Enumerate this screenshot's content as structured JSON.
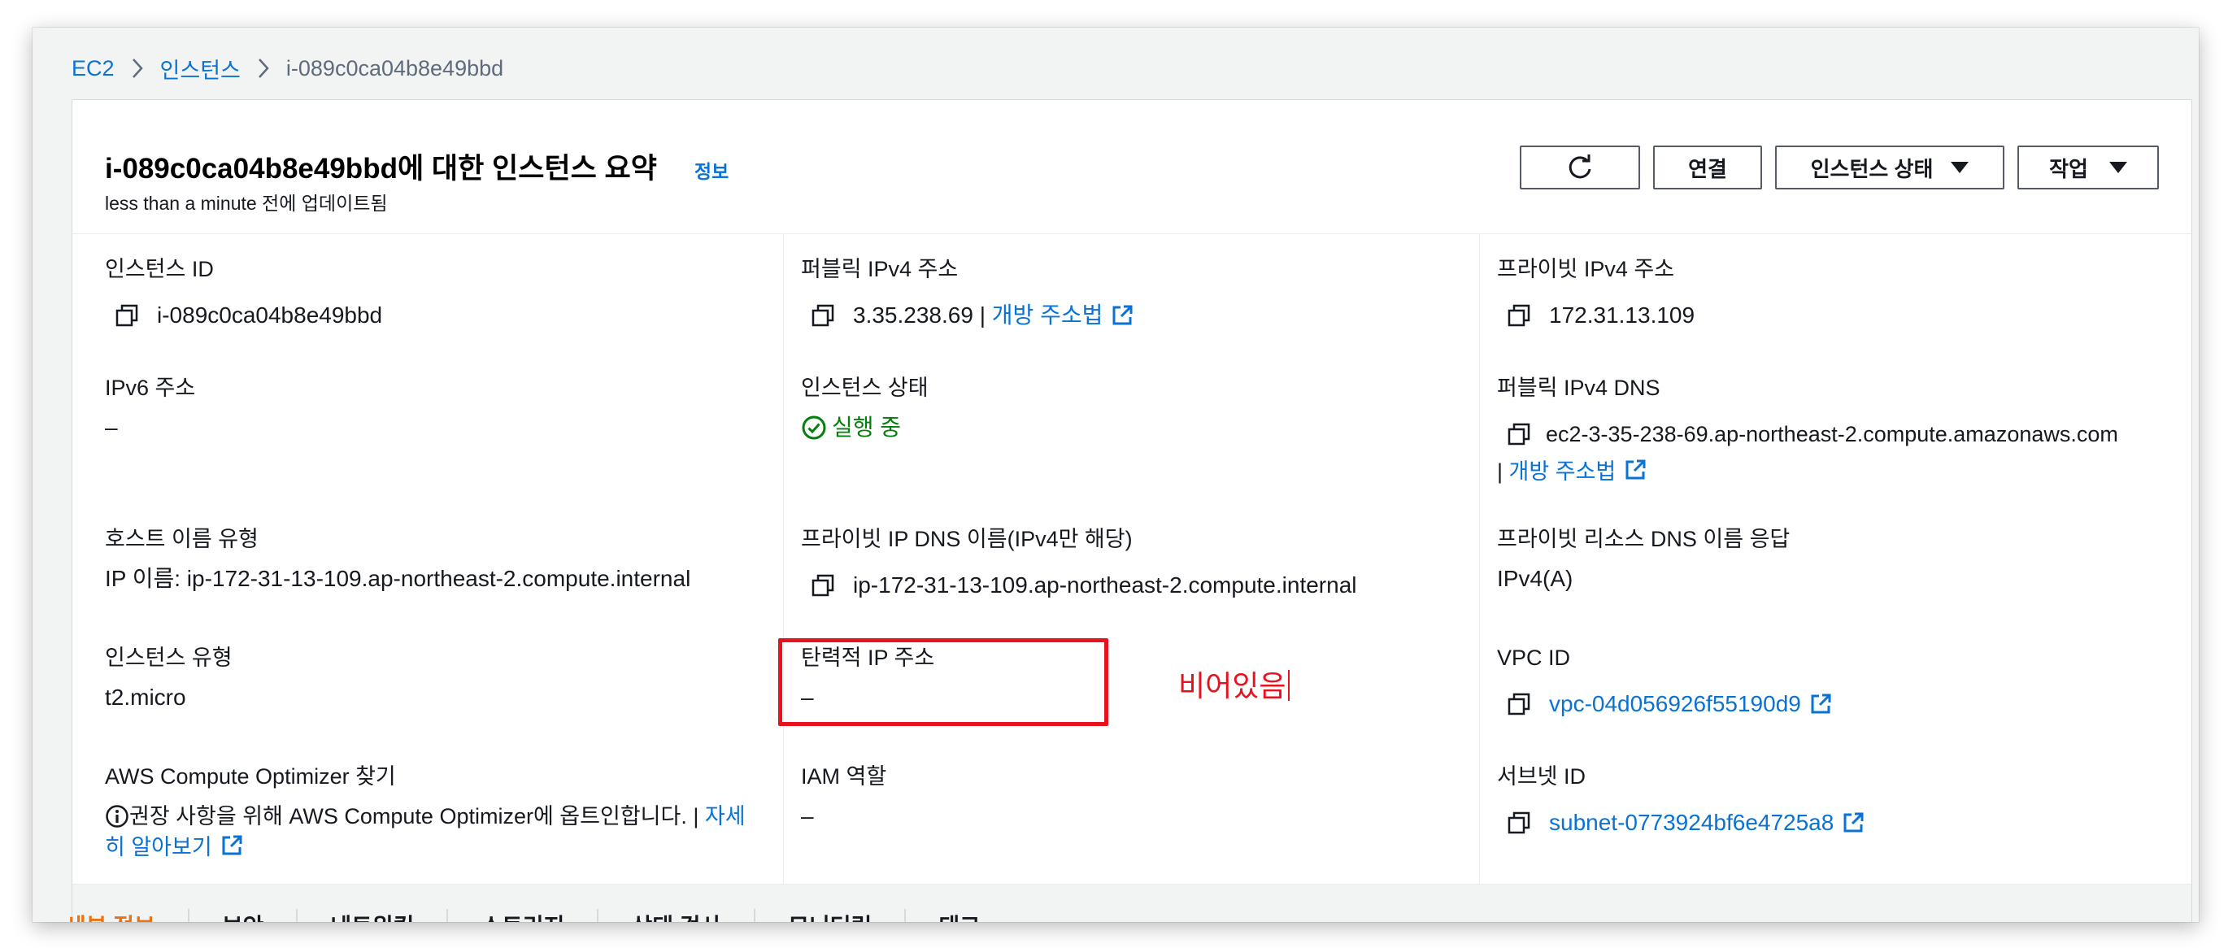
{
  "breadcrumb": {
    "root": "EC2",
    "section": "인스턴스",
    "current": "i-089c0ca04b8e49bbd"
  },
  "header": {
    "title": "i-089c0ca04b8e49bbd에 대한 인스턴스 요약",
    "info_link": "정보",
    "subtitle": "less than a minute 전에 업데이트됨",
    "buttons": {
      "connect": "연결",
      "instance_state": "인스턴스 상태",
      "actions": "작업"
    }
  },
  "fields": {
    "instance_id": {
      "label": "인스턴스 ID",
      "value": "i-089c0ca04b8e49bbd"
    },
    "public_ipv4": {
      "label": "퍼블릭 IPv4 주소",
      "value": "3.35.238.69",
      "sep": " | ",
      "link": "개방 주소법"
    },
    "private_ipv4": {
      "label": "프라이빗 IPv4 주소",
      "value": "172.31.13.109"
    },
    "ipv6": {
      "label": "IPv6 주소",
      "value": "–"
    },
    "instance_state": {
      "label": "인스턴스 상태",
      "value": "실행 중"
    },
    "public_dns": {
      "label": "퍼블릭 IPv4 DNS",
      "value": "ec2-3-35-238-69.ap-northeast-2.compute.amazonaws.com",
      "sep": "| ",
      "link": "개방 주소법"
    },
    "hostname_type": {
      "label": "호스트 이름 유형",
      "value": "IP 이름: ip-172-31-13-109.ap-northeast-2.compute.internal"
    },
    "private_dns": {
      "label": "프라이빗 IP DNS 이름(IPv4만 해당)",
      "value": "ip-172-31-13-109.ap-northeast-2.compute.internal"
    },
    "private_resource_dns": {
      "label": "프라이빗 리소스 DNS 이름 응답",
      "value": "IPv4(A)"
    },
    "instance_type": {
      "label": "인스턴스 유형",
      "value": "t2.micro"
    },
    "elastic_ip": {
      "label": "탄력적 IP 주소",
      "value": "–"
    },
    "vpc_id": {
      "label": "VPC ID",
      "value": "vpc-04d056926f55190d9"
    },
    "compute_optimizer": {
      "label": "AWS Compute Optimizer 찾기",
      "text": "권장 사항을 위해 AWS Compute Optimizer에 옵트인합니다. | ",
      "link_part1": "자세",
      "link_part2": "히 알아보기"
    },
    "iam_role": {
      "label": "IAM 역할",
      "value": "–"
    },
    "subnet_id": {
      "label": "서브넷 ID",
      "value": "subnet-0773924bf6e4725a8"
    }
  },
  "annotation": {
    "text": "비어있음",
    "color": "#e8121e"
  },
  "tabs": [
    "세부 정보",
    "보안",
    "네트워킹",
    "스토리지",
    "상태 검사",
    "모니터링",
    "태그"
  ],
  "colors": {
    "link": "#0972d3",
    "running": "#037f0c",
    "active_tab": "#ec7211",
    "highlight": "#e8121e"
  },
  "icons": {
    "copy": "copy-icon",
    "external": "external-link-icon",
    "refresh": "refresh-icon",
    "status": "check-circle-icon",
    "info": "info-circle-icon",
    "separator": "chevron-right-icon",
    "dropdown": "caret-down-icon"
  }
}
